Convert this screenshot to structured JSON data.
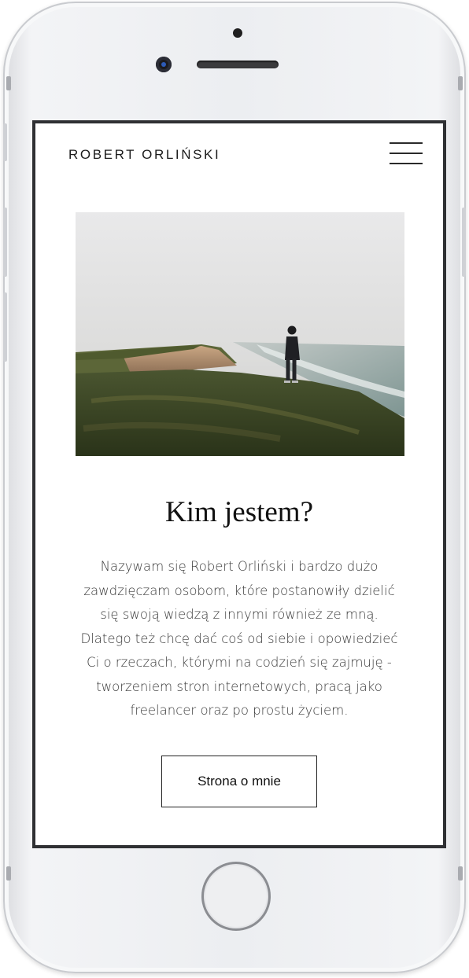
{
  "header": {
    "brand": "ROBERT ORLIŃSKI",
    "menu_icon": "hamburger-menu-icon"
  },
  "hero_image": {
    "alt": "Person standing on a foggy cliff overlooking the sea"
  },
  "about": {
    "title": "Kim jestem?",
    "paragraph_lines": [
      "Nazywam się Robert Orliński i bardzo dużo",
      "zawdzięczam osobom, które postanowiły dzielić",
      "się swoją wiedzą z innymi również ze mną.",
      "Dlatego też chcę dać coś od siebie i opowiedzieć",
      "Ci o rzeczach, którymi na codzień się zajmuję -",
      "tworzeniem stron internetowych, pracą jako",
      "freelancer oraz po prostu życiem."
    ],
    "button_label": "Strona o mnie"
  },
  "colors": {
    "text": "#111111",
    "frame": "#2f3033",
    "phone_body": "#eceef1"
  }
}
